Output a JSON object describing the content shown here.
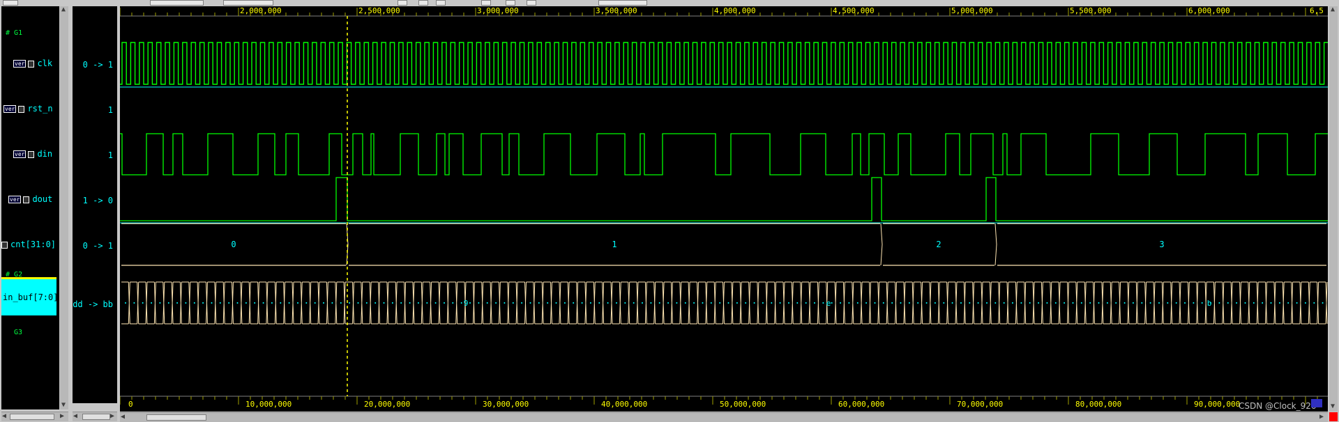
{
  "groups": {
    "g1": "G1",
    "g2": "G2",
    "g3": "G3"
  },
  "signals": [
    {
      "badge": "ver",
      "name": "clk",
      "value": "0 -> 1"
    },
    {
      "badge": "ver",
      "name": "rst_n",
      "value": "1"
    },
    {
      "badge": "ver",
      "name": "din",
      "value": "1"
    },
    {
      "badge": "ver",
      "name": "dout",
      "value": "1 -> 0"
    },
    {
      "badge": "",
      "name": "cnt[31:0]",
      "value": "0 -> 1"
    },
    {
      "badge": "",
      "name": "in_buf[7:0]",
      "value": "dd -> bb"
    }
  ],
  "cnt_segments": [
    "0",
    "1",
    "2",
    "3"
  ],
  "in_buf_samples": [
    "9",
    "e",
    "b"
  ],
  "ruler_top": [
    "2,000,000",
    "2,500,000",
    "3,000,000",
    "3,500,000",
    "4,000,000",
    "4,500,000",
    "5,000,000",
    "5,500,000",
    "6,000,000",
    "6,5"
  ],
  "ruler_bottom": [
    "0",
    "10,000,000",
    "20,000,000",
    "30,000,000",
    "40,000,000",
    "50,000,000",
    "60,000,000",
    "70,000,000",
    "80,000,000",
    "90,000,000"
  ],
  "watermark": "CSDN @Clock_926",
  "colors": {
    "wave_green": "#00ff00",
    "wave_cyan": "#00ffff",
    "bus_outline": "#ffe6b3",
    "cursor": "#ffff00",
    "ruler_text": "#ffff00",
    "background": "#000000"
  },
  "icons": [
    "lock-icon",
    "scroll-left-arrow-icon",
    "scroll-right-arrow-icon",
    "scroll-up-arrow-icon",
    "scroll-down-arrow-icon"
  ]
}
